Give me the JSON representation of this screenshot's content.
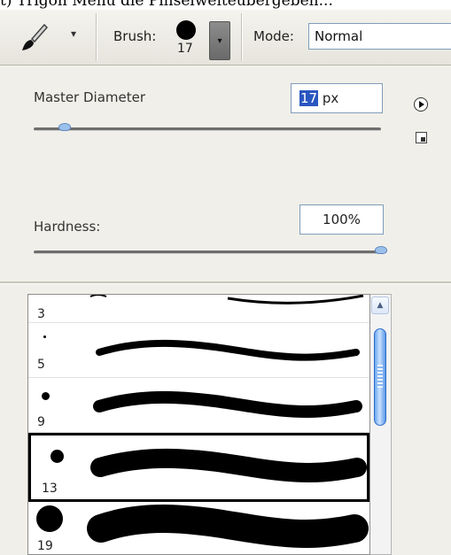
{
  "caption": "t) Trigon Menu die Pinselweiteübergeben...",
  "toolbar": {
    "tool_icon": "brush-tool-icon",
    "preset_arrow": "▾",
    "brush_label": "Brush:",
    "brush_size": "17",
    "brush_dropdown_arrow": "▾",
    "mode_label": "Mode:",
    "mode_value": "Normal"
  },
  "panel": {
    "master_diameter_label": "Master Diameter",
    "master_diameter_value": "17",
    "master_diameter_unit": " px",
    "master_diameter_level": 0.09,
    "hardness_label": "Hardness:",
    "hardness_value": "100%",
    "hardness_level": 1.0,
    "menu_button_icon": "flyout-menu-icon",
    "new_preset_icon": "new-preset-icon"
  },
  "brush_list": {
    "selected_index": 3,
    "items": [
      {
        "size": "3"
      },
      {
        "size": "5"
      },
      {
        "size": "9"
      },
      {
        "size": "13"
      },
      {
        "size": "19"
      }
    ]
  },
  "colors": {
    "selection_highlight": "#2a56c0",
    "scroll_thumb": "#6aa7f0",
    "slider_thumb": "#9cc0ec"
  }
}
